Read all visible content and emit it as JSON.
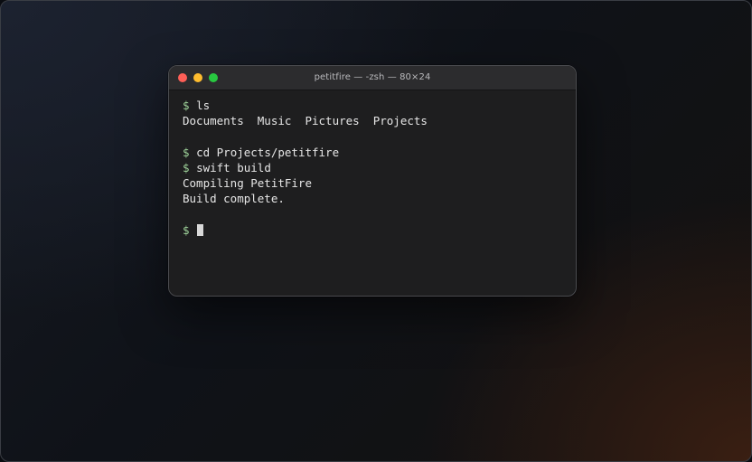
{
  "window": {
    "title": "petitfire — -zsh — 80×24"
  },
  "terminal": {
    "prompt": "$",
    "lines": [
      {
        "type": "command",
        "text": "ls"
      },
      {
        "type": "output",
        "text": "Documents  Music  Pictures  Projects"
      },
      {
        "type": "blank",
        "text": ""
      },
      {
        "type": "command",
        "text": "cd Projects/petitfire"
      },
      {
        "type": "command",
        "text": "swift build"
      },
      {
        "type": "output",
        "text": "Compiling PetitFire"
      },
      {
        "type": "output",
        "text": "Build complete."
      },
      {
        "type": "blank",
        "text": ""
      },
      {
        "type": "input",
        "text": ""
      }
    ]
  },
  "colors": {
    "prompt": "#9fd39a",
    "close": "#fe5f57",
    "minimize": "#febc2e",
    "maximize": "#28c840"
  }
}
